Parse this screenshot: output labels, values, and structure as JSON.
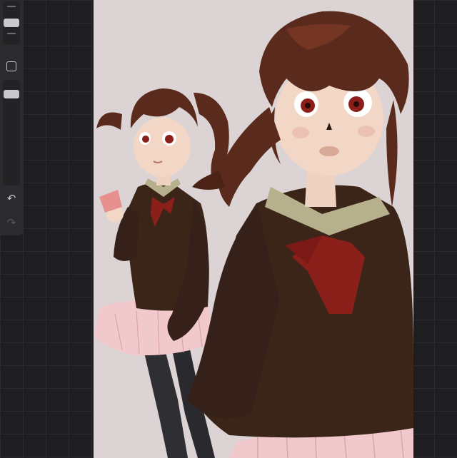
{
  "app": {
    "accent_color": "#c9c9cc",
    "canvas_background": "#dcd3d5",
    "workspace_background": "#1e1e20"
  },
  "sidebar": {
    "brush_size_slider": {
      "value": 0.5
    },
    "modifier_button_icon": "square-outline-icon",
    "opacity_slider": {
      "value": 0.9
    },
    "undo_icon": "undo-arrow-icon",
    "redo_icon": "redo-arrow-icon",
    "redo_enabled": false
  },
  "artwork": {
    "palette": {
      "hair": "#5a2a1c",
      "sweater": "#3b2519",
      "collar": "#b7b08d",
      "bow": "#8b1f1a",
      "skirt": "#f1c9cc",
      "skin": "#f2d7c6",
      "tights": "#2f2f33"
    }
  }
}
